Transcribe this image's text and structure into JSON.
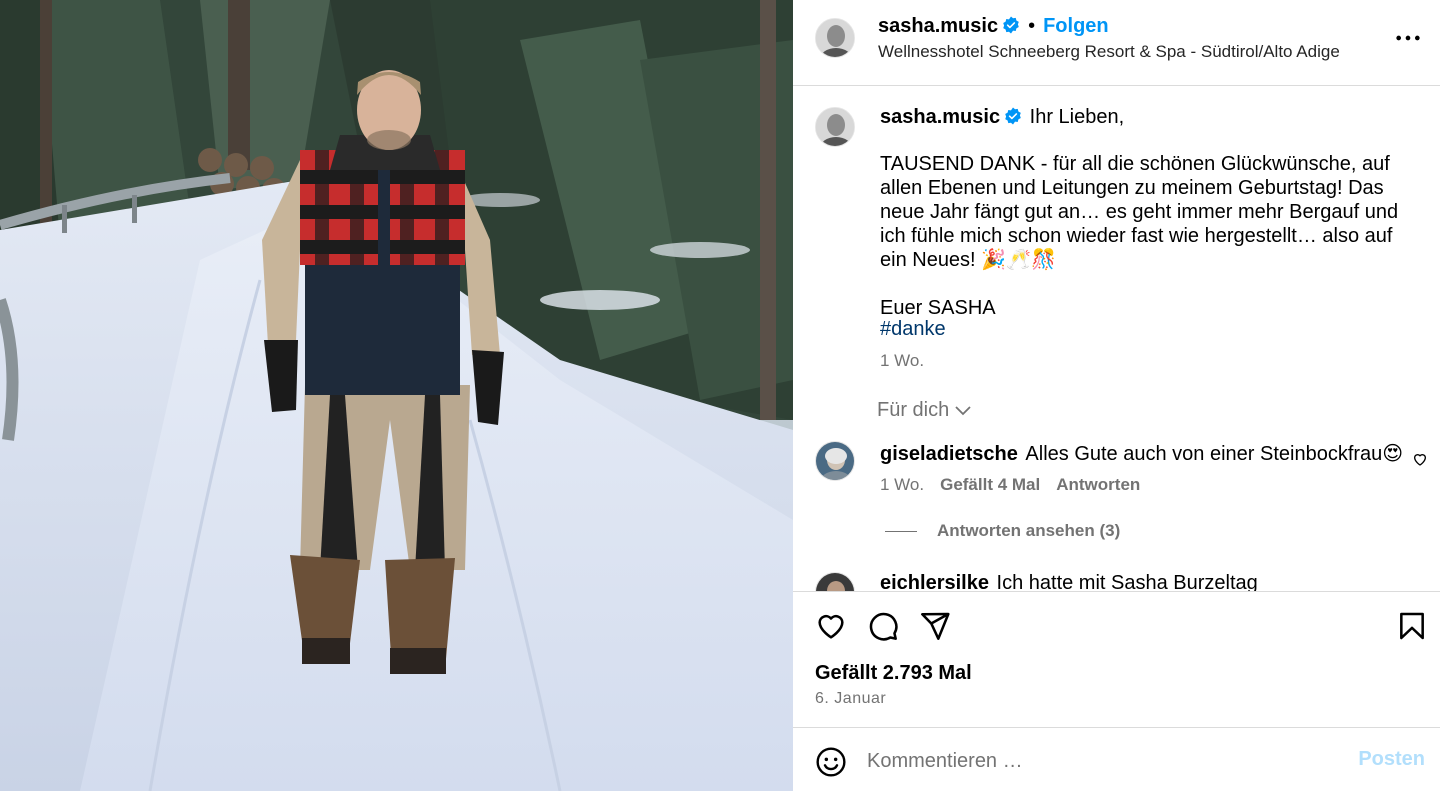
{
  "post": {
    "author": "sasha.music",
    "follow_label": "Folgen",
    "location": "Wellnesshotel Schneeberg Resort & Spa - Südtirol/Alto Adige",
    "separator": "•",
    "image_alt": "Mann in Winterjacke auf verschneitem Weg im Wald"
  },
  "caption": {
    "author": "sasha.music",
    "first_line": "Ihr Lieben,",
    "body": "TAUSEND DANK - für all die schönen Glückwünsche, auf allen Ebenen und Leitungen zu meinem Geburtstag! Das neue Jahr fängt gut an… es geht immer mehr Bergauf und ich fühle mich schon wieder fast wie hergestellt… also auf ein Neues! 🎉🥂🎊\n\nEuer SASHA",
    "hashtag": "#danke",
    "time": "1 Wo."
  },
  "sort_label": "Für dich",
  "comments": [
    {
      "author": "giseladietsche",
      "text": "Alles Gute auch von einer Steinbockfrau😍",
      "time": "1 Wo.",
      "likes": "Gefällt 4 Mal",
      "reply_label": "Antworten",
      "view_replies": "Antworten ansehen (3)"
    },
    {
      "author": "eichlersilke",
      "text": "Ich hatte mit Sasha Burzeltag"
    }
  ],
  "actions": {
    "like_icon": "heart-icon",
    "comment_icon": "comment-icon",
    "share_icon": "send-icon",
    "save_icon": "bookmark-icon"
  },
  "stats": {
    "likes": "Gefällt 2.793 Mal",
    "date": "6. Januar"
  },
  "composer": {
    "placeholder": "Kommentieren …",
    "post_label": "Posten"
  },
  "colors": {
    "link_blue": "#0095f6",
    "hashtag_blue": "#00376b",
    "muted": "#737373",
    "border": "#dbdbdb",
    "post_disabled": "#b2dffc"
  }
}
